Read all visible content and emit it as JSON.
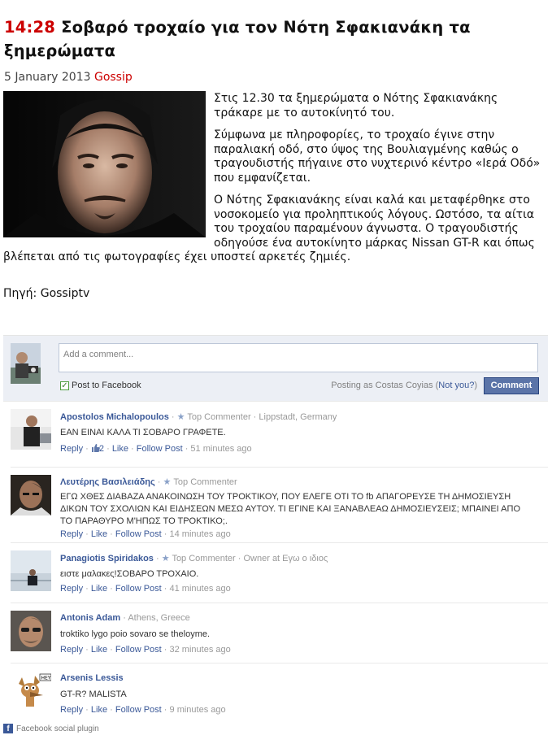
{
  "article": {
    "time": "14:28",
    "title": "Σοβαρό τροχαίο για τον Νότη Σφακιανάκη τα ξημερώματα",
    "date": "5 January 2013",
    "category": "Gossip",
    "paragraphs": [
      "Στις 12.30 τα ξημερώματα ο Νότης Σφακιανάκης τράκαρε με το αυτοκίνητό του.",
      "Σύμφωνα με πληροφορίες, το τροχαίο έγινε στην παραλιακή οδό, στο ύψος της Βουλιαγμένης καθώς ο τραγουδιστής πήγαινε στο νυχτερινό κέντρο «Ιερά Οδό» που εμφανίζεται.",
      "Ο Νότης Σφακιανάκης είναι καλά και μεταφέρθηκε στο νοσοκομείο για προληπτικούς λόγους. Ωστόσο, τα αίτια του τροχαίου παραμένουν άγνωστα. Ο τραγουδιστής οδηγούσε ένα αυτοκίνητο μάρκας Nissan GT-R και όπως βλέπεται από τις φωτογραφίες έχει υποστεί αρκετές ζημιές."
    ],
    "source": "Πηγή: Gossiptv"
  },
  "comment_form": {
    "placeholder": "Add a comment...",
    "post_to_label": "Post to Facebook",
    "posting_as_prefix": "Posting as Costas Coyias (",
    "not_you_link": "Not you?",
    "posting_as_suffix": ")",
    "submit_label": "Comment"
  },
  "comments": [
    {
      "name": "Apostolos Michalopoulos",
      "badge": "Top Commenter",
      "meta": "Lippstadt, Germany",
      "text": "ΕΑΝ ΕΙΝΑΙ ΚΑΛΑ ΤΙ ΣΟΒΑΡΟ ΓΡΑΦΕΤΕ.",
      "reply": "Reply",
      "likes": "2",
      "like": "Like",
      "follow": "Follow Post",
      "time": "51 minutes ago"
    },
    {
      "name": "Λευτέρης Βασιλειάδης",
      "badge": "Top Commenter",
      "meta": "",
      "text": "ΕΓΩ ΧΘΕΣ ΔΙΑΒΑΖΑ ΑΝΑΚΟΙΝΩΣΗ ΤΟΥ ΤΡΟΚΤΙΚΟΥ, ΠΟΥ ΕΛΕΓΕ ΟΤΙ ΤΟ fb ΑΠΑΓΟΡΕΥΣΕ ΤΗ ΔΗΜΟΣΙΕΥΣΗ ΔΙΚΩΝ ΤΟΥ ΣΧΟΛΙΩΝ ΚΑΙ ΕΙΔΗΣΕΩΝ ΜΕΣΩ ΑΥΤΟΥ. ΤΙ ΕΓΙΝΕ ΚΑΙ ΞΑΝΑΒΛΕΑΩ ΔΗΜΟΣΙΕΥΣΕΙΣ; ΜΠΑΙΝΕΙ ΑΠΟ ΤΟ ΠΑΡΑΘΥΡΟ Μ'ΗΠΩΣ ΤΟ ΤΡΟΚΤΙΚΟ;.",
      "reply": "Reply",
      "likes": "",
      "like": "Like",
      "follow": "Follow Post",
      "time": "14 minutes ago"
    },
    {
      "name": "Panagiotis Spiridakos",
      "badge": "Top Commenter",
      "meta": "Owner at Εγω ο ιδιος",
      "text": "ειστε μαλακες!ΣΟΒΑΡΟ ΤΡΟΧΑΙΟ.",
      "reply": "Reply",
      "likes": "",
      "like": "Like",
      "follow": "Follow Post",
      "time": "41 minutes ago"
    },
    {
      "name": "Antonis Adam",
      "badge": "",
      "meta": "Athens, Greece",
      "text": "troktiko lygo poio sovaro se theloyme.",
      "reply": "Reply",
      "likes": "",
      "like": "Like",
      "follow": "Follow Post",
      "time": "32 minutes ago"
    },
    {
      "name": "Arsenis Lessis",
      "badge": "",
      "meta": "",
      "text": "GT-R? MALISTA",
      "reply": "Reply",
      "likes": "",
      "like": "Like",
      "follow": "Follow Post",
      "time": "9 minutes ago"
    }
  ],
  "footer": {
    "label": "Facebook social plugin"
  },
  "colors": {
    "accent_red": "#cc0000",
    "facebook_blue": "#3b5998",
    "button_blue": "#5b74a8",
    "widget_bg": "#eceff5"
  },
  "icons": [
    "star-icon",
    "like-thumb-icon",
    "checkmark-icon",
    "facebook-logo-icon"
  ]
}
